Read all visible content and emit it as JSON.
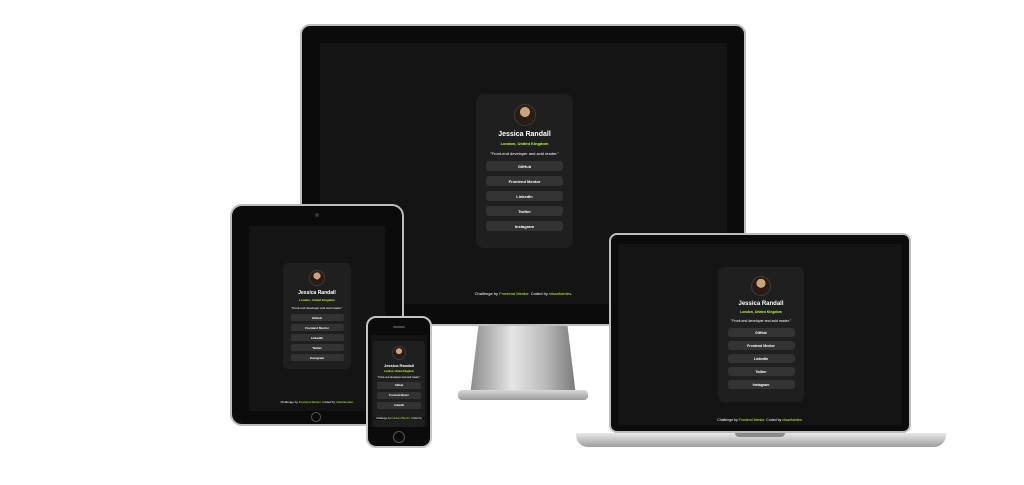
{
  "profile": {
    "name": "Jessica Randall",
    "location": "London, United Kingdom",
    "bio": "\"Front-end developer and avid reader.\"",
    "links": [
      "GitHub",
      "Frontend Mentor",
      "LinkedIn",
      "Twitter",
      "Instagram"
    ]
  },
  "footer": {
    "prefix": "Challenge by ",
    "challenge_link": "Frontend Mentor",
    "middle": ". Coded by ",
    "author_link": "rdsanfuertes",
    "suffix": "."
  },
  "colors": {
    "page_bg": "#141414",
    "card_bg": "#1f1f1f",
    "button_bg": "#333333",
    "accent": "#c4f82a",
    "text": "#ffffff"
  }
}
